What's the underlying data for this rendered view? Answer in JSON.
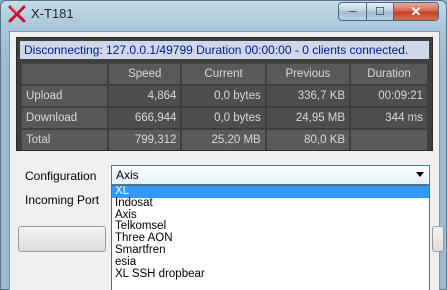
{
  "window": {
    "title": "X-T181",
    "controls": {
      "minimize": "─",
      "maximize": "☐",
      "close": "✕"
    }
  },
  "status_text": "Disconnecting: 127.0.0.1/49799 Duration 00:00:00 - 0 clients connected.",
  "stats_table": {
    "headers": [
      "",
      "Speed",
      "Current",
      "Previous",
      "Duration"
    ],
    "rows": [
      {
        "label": "Upload",
        "speed": "4,864",
        "current": "0,0 bytes",
        "previous": "336,7 KB",
        "duration": "00:09:21"
      },
      {
        "label": "Download",
        "speed": "666,944",
        "current": "0,0 bytes",
        "previous": "24,95 MB",
        "duration": "344 ms"
      },
      {
        "label": "Total",
        "speed": "799,312",
        "current": "25,20 MB",
        "previous": "80,0 KB",
        "duration": ""
      }
    ]
  },
  "form": {
    "configuration_label": "Configuration",
    "incoming_port_label": "Incoming Port",
    "configuration_selected": "Axis"
  },
  "dropdown_options": [
    {
      "label": "XL",
      "selected": true
    },
    {
      "label": "Indosat",
      "selected": false
    },
    {
      "label": "Axis",
      "selected": false
    },
    {
      "label": "Telkomsel",
      "selected": false
    },
    {
      "label": "Three AON",
      "selected": false
    },
    {
      "label": "Smartfren",
      "selected": false
    },
    {
      "label": "esia",
      "selected": false
    },
    {
      "label": "XL SSH dropbear",
      "selected": false
    }
  ],
  "colors": {
    "status_text": "#00208c",
    "status_bg": "#cfd7e8",
    "grid_bg": "#3f3f3f",
    "selection": "#3399ff",
    "app_icon": "#c8102e"
  },
  "icons": {
    "app": "x-logo-icon",
    "dropdown": "chevron-down-icon"
  }
}
